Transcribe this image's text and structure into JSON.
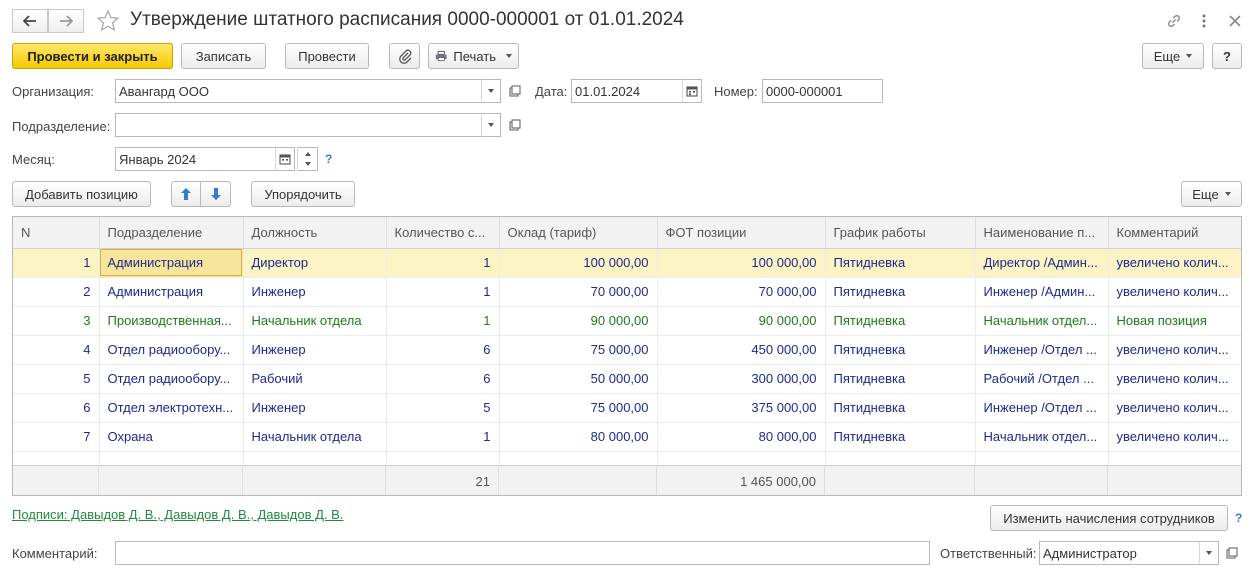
{
  "window": {
    "title": "Утверждение штатного расписания 0000-000001 от 01.01.2024"
  },
  "toolbar": {
    "post_close": "Провести и закрыть",
    "save": "Записать",
    "post": "Провести",
    "print": "Печать",
    "more": "Еще",
    "help": "?"
  },
  "form": {
    "org_label": "Организация:",
    "org_value": "Авангард ООО",
    "date_label": "Дата:",
    "date_value": "01.01.2024",
    "number_label": "Номер:",
    "number_value": "0000-000001",
    "dept_label": "Подразделение:",
    "dept_value": "",
    "month_label": "Месяц:",
    "month_value": "Январь 2024",
    "month_help": "?"
  },
  "table_toolbar": {
    "add": "Добавить позицию",
    "sort": "Упорядочить",
    "more": "Еще"
  },
  "table": {
    "columns": [
      "N",
      "Подразделение",
      "Должность",
      "Количество с...",
      "Оклад (тариф)",
      "ФОТ  позиции",
      "График работы",
      "Наименование п...",
      "Комментарий"
    ],
    "rows": [
      {
        "n": "1",
        "dept": "Администрация",
        "position": "Директор",
        "qty": "1",
        "salary": "100 000,00",
        "fot": "100 000,00",
        "schedule": "Пятидневка",
        "name": "Директор /Админ...",
        "comment": "увеличено колич...",
        "style": "blue",
        "selected": true
      },
      {
        "n": "2",
        "dept": "Администрация",
        "position": "Инженер",
        "qty": "1",
        "salary": "70 000,00",
        "fot": "70 000,00",
        "schedule": "Пятидневка",
        "name": "Инженер /Админ...",
        "comment": "увеличено колич...",
        "style": "blue",
        "selected": false
      },
      {
        "n": "3",
        "dept": "Производственная...",
        "position": "Начальник отдела",
        "qty": "1",
        "salary": "90 000,00",
        "fot": "90 000,00",
        "schedule": "Пятидневка",
        "name": "Начальник отдел...",
        "comment": "Новая позиция",
        "style": "green",
        "selected": false
      },
      {
        "n": "4",
        "dept": "Отдел радиообору...",
        "position": "Инженер",
        "qty": "6",
        "salary": "75 000,00",
        "fot": "450 000,00",
        "schedule": "Пятидневка",
        "name": "Инженер /Отдел ...",
        "comment": "увеличено колич...",
        "style": "blue",
        "selected": false
      },
      {
        "n": "5",
        "dept": "Отдел радиообору...",
        "position": "Рабочий",
        "qty": "6",
        "salary": "50 000,00",
        "fot": "300 000,00",
        "schedule": "Пятидневка",
        "name": "Рабочий /Отдел ...",
        "comment": "увеличено колич...",
        "style": "blue",
        "selected": false
      },
      {
        "n": "6",
        "dept": "Отдел электротехн...",
        "position": "Инженер",
        "qty": "5",
        "salary": "75 000,00",
        "fot": "375 000,00",
        "schedule": "Пятидневка",
        "name": "Инженер /Отдел ...",
        "comment": "увеличено колич...",
        "style": "blue",
        "selected": false
      },
      {
        "n": "7",
        "dept": "Охрана",
        "position": "Начальник отдела",
        "qty": "1",
        "salary": "80 000,00",
        "fot": "80 000,00",
        "schedule": "Пятидневка",
        "name": "Начальник отдел...",
        "comment": "увеличено колич...",
        "style": "blue",
        "selected": false
      }
    ],
    "totals": {
      "qty": "21",
      "fot": "1 465 000,00"
    }
  },
  "bottom": {
    "signatures_link": "Подписи: Давыдов Д. В., Давыдов Д. В., Давыдов Д. В.",
    "change_accruals": "Изменить начисления сотрудников",
    "help": "?",
    "comment_label": "Комментарий:",
    "comment_value": "",
    "responsible_label": "Ответственный:",
    "responsible_value": "Администратор"
  },
  "colors": {
    "primary_button": "#f6c900",
    "row_blue": "#1b2a8f",
    "row_green": "#1f7a1f",
    "selected_row": "#fbf3c4",
    "link_green": "#1f8a3a",
    "help_blue": "#3c7fc0"
  }
}
